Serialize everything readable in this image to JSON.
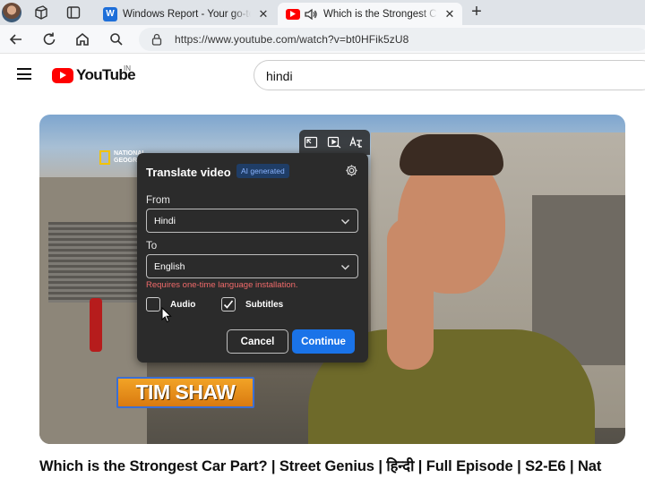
{
  "browser": {
    "tabs": [
      {
        "title": "Windows Report - Your go-to so",
        "favicon": "W",
        "favicon_color": "#1e6fd9",
        "active": false
      },
      {
        "title": "Which is the Strongest Car P",
        "favicon": "youtube-icon",
        "favicon_color": "#ff0000",
        "active": true
      }
    ],
    "address": "https://www.youtube.com/watch?v=bt0HFik5zU8"
  },
  "youtube": {
    "logo_text": "YouTube",
    "country_code": "IN",
    "search_query": "hindi"
  },
  "video": {
    "channel_watermark": "NATIONAL\nGEOGRAPHIC",
    "nameplate": "TIM SHAW",
    "title": "Which is the Strongest Car Part? | Street Genius | हिन्दी | Full Episode | S2-E6 | Nat"
  },
  "translate_panel": {
    "title": "Translate video",
    "badge": "AI generated",
    "from_label": "From",
    "from_value": "Hindi",
    "to_label": "To",
    "to_value": "English",
    "warning": "Requires one-time language installation.",
    "audio_label": "Audio",
    "audio_checked": false,
    "subtitles_label": "Subtitles",
    "subtitles_checked": true,
    "cancel_label": "Cancel",
    "continue_label": "Continue",
    "accent_color": "#1a73e8",
    "warning_color": "#f06a6a"
  }
}
